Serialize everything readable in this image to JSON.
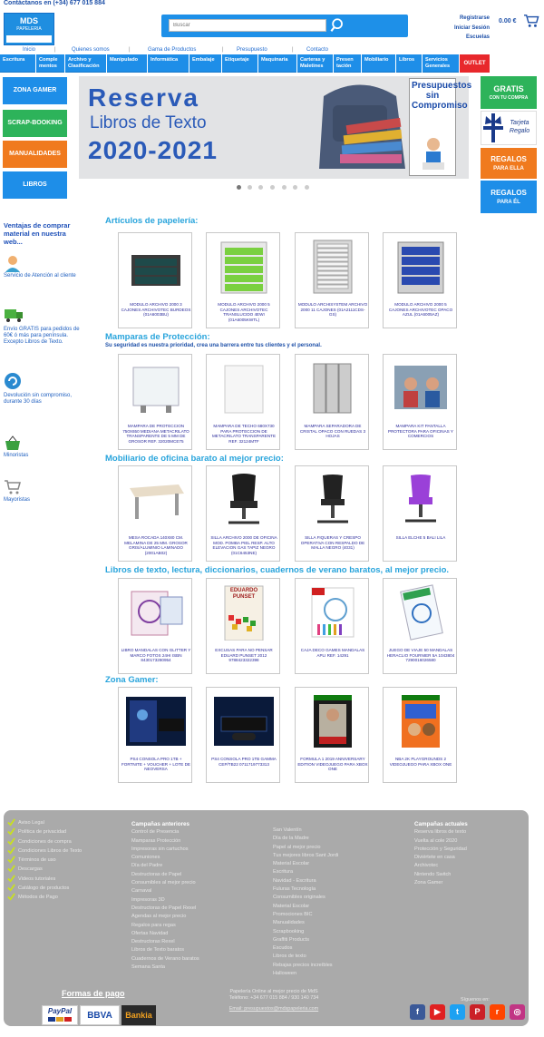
{
  "header": {
    "contact_line": "Contáctanos en (+34) 677 015 884",
    "logo_title": "MDS",
    "logo_sub": "PAPELERIA",
    "search_placeholder": "Buscar",
    "account_links": [
      "Registrarse",
      "Iniciar Sesión",
      "Escuelas"
    ],
    "cart_total": "0.00 €"
  },
  "top_links": [
    "Inicio",
    "Quienes somos",
    "Gama de Productos",
    "Presupuesto",
    "Contacto"
  ],
  "categories": [
    "Escritura",
    "Comple mentos",
    "Archivo y Clasificación",
    "Manipulado",
    "Informática",
    "Embalaje",
    "Etiquetaje",
    "Maquinaria",
    "Carteras y Maletines",
    "Presen tación",
    "Mobiliario",
    "Libros",
    "Servicios Generales"
  ],
  "outlet_label": "OUTLET",
  "left_buttons": [
    {
      "label": "ZONA GAMER",
      "color": "#1e8ee8"
    },
    {
      "label": "SCRAP-BOOKING",
      "color": "#2db35a"
    },
    {
      "label": "MANUALIDADES",
      "color": "#f07a1e"
    },
    {
      "label": "LIBROS",
      "color": "#1e8ee8"
    }
  ],
  "banner": {
    "line1": "Reserva",
    "line2": "Libros de Texto",
    "line3": "2020-2021",
    "side_text": "Presupuestos sin Compromiso"
  },
  "right_buttons": [
    {
      "label": "GRATIS",
      "sub": "CON TU COMPRA",
      "color": "#2db35a"
    },
    {
      "label": "Tarjeta Regalo",
      "sub": "",
      "color": "#ffffff"
    },
    {
      "label": "REGALOS",
      "sub": "PARA ELLA",
      "color": "#f07a1e"
    },
    {
      "label": "REGALOS",
      "sub": "PARA ÉL",
      "color": "#1e8ee8"
    }
  ],
  "advantages": {
    "title": "Ventajas de comprar material en nuestra web...",
    "items": [
      "Servicio de Atención al cliente",
      "Envío GRATIS para pedidos de 60€ ó más para península. Excepto Libros de Texto.",
      "Devolución sin compromiso, durante 30 días",
      "Minoristas",
      "Mayoristas"
    ]
  },
  "sections": [
    {
      "title": "Artículos de papelería:",
      "subtitle": "",
      "products": [
        "MODULO ARCHIVO 2000 3 CAJONES ARCHIVOTEC BURDEOS (01A6003BU)",
        "MODULO ARCHIVO 2000 5 CAJONES ARCHIVOTEC TRANSLUCIDO 4EWI (01A6005KWTL)",
        "MODULO ARCHISYSTEM ARCHIVO 2000 11 CAJONES (01A2111CDS-GS)",
        "MODULO ARCHIVO 2000 5 CAJONES ARCHIVOTEC OPACO AZUL (01A6005AZ)"
      ]
    },
    {
      "title": "Mamparas de Protección:",
      "subtitle": "Su seguridad es nuestra prioridad, crea una barrera entre tus clientes y el personal.",
      "products": [
        "MAMPARA DE PROTECCION 750x650 MEDIANA METACRILATO TRANSPARENTE DE 5 MM DE GROSOR REF. 32020MCE75",
        "MAMPARA DE TECHO 680x730 PARA PROTECCION DE METACRILATO TRANSPARENTE REF. 32124MTF",
        "MAMPARA SEPARADORA DE CRISTAL OPACO CON RUEDAS 3 HOJAS",
        "MAMPARA KIT PANTALLA PROTECTORA PARA OFICINAS Y COMERCIOS"
      ]
    },
    {
      "title": "Mobiliario de oficina barato al mejor precio:",
      "subtitle": "",
      "products": [
        "MESA ROCADA 140X80 CM. MELAMINA DE 25 MM. GROSOR GRIS/ALUMINIO LAMINADO (2001AB02)",
        "SILLA ARCHIVO 2000 DE OFICINA MOD. POMBA PIEL RESP. ALTO ELEVACION GAS TAPIZ NEGRO (01C6453NE)",
        "SILLA FIQUERAS Y CRESPO OPERATIVA CON RESPALDO DE MALLA NEGRO (4031)",
        "SILLA ELCHE 5 BALI LILA"
      ]
    },
    {
      "title": "Libros de texto, lectura, diccionarios, cuadernos de verano baratos, al mejor precio.",
      "subtitle": "",
      "products": [
        "LIBRO MANDALAS CON GLITTER Y MARCO FOTOS 24HI ISBN 8430173280954",
        "EXCUSAS PARA NO PENSAR EDUARD PUNSET 2012 9788423322398",
        "CAJA DECO GAMES MANDALAS APLI REF. 14291",
        "JUEGO DE VIAJE 50 MANDALAS HERACLIO FOURNIER 5A 1043804 7290016026580"
      ]
    },
    {
      "title": "Zona Gamer:",
      "subtitle": "",
      "products": [
        "PS4 CONSOLA PRO 1TB + FORTNITE + VOUCHER + LOTE DE NEOVERSA",
        "PS4 CONSOLA PRO 1TB GAMMA CEP/TB22 0711719773313",
        "FORMULA 1 2019 ANNIVERSARY EDITION VIDEOJUEGO PARA XBOX ONE",
        "NBA 2K PLAYGROUNDS 2 VIDEOJUEGO PARA XBOX ONE"
      ]
    }
  ],
  "book_cover_text": "EDUARDO PUNSET",
  "footer": {
    "col1": [
      "Aviso Legal",
      "Política de privacidad",
      "Condiciones de compra",
      "Condiciones Libros de Texto",
      "Términos de uso",
      "Descargas",
      "Videos tutoriales",
      "Catálogo de productos",
      "Métodos de Pago"
    ],
    "col2_title": "Campañas anteriores",
    "col2": [
      "Control de Presencia",
      "Mamparas Protección",
      "Impresoras sin cartuchos",
      "Comuniones",
      "Día del Padre",
      "Destructoras de Papel",
      "Consumibles al mejor precio",
      "Carnaval",
      "Impresoras 3D",
      "Destructoras de Papel Rexel",
      "Agendas al mejor precio",
      "Regalos para regas",
      "Ofertas Navidad",
      "Destructoras Rexel",
      "Libros de Texto baratos",
      "Cuadernos de Verano baratos",
      "Semana Santa"
    ],
    "col3": [
      "San Valentín",
      "Día de la Madre",
      "Papel al mejor precio",
      "Tus mejores libros Sant Jordi",
      "Material Escolar",
      "Escritura",
      "Navidad - Escritura",
      "Fuluras Tecnología",
      "Consumibles originales",
      "Material Escolar",
      "Promociones BIC",
      "Manualidades",
      "Scrapbooking",
      "Graffiti Products",
      "Escudos",
      "Libros de texto",
      "Rebajas precios increíbles",
      "Halloween"
    ],
    "col4_title": "Campañas actuales",
    "col4": [
      "Reserva libros de texto",
      "Vuelta al cole 2020",
      "Protección y Seguridad",
      "Diviértete en casa",
      "Archivotec",
      "Nintendo Switch",
      "Zona Gamer"
    ],
    "payment_title": "Formas de pago",
    "payment_logos": [
      "PayPal",
      "BBVA",
      "Bankia"
    ],
    "company": "Papelería Online al mejor precio de MdS",
    "phone": "Teléfono: +34 677 015 884 / 930 140 734",
    "email": "Email: presupuestos@mdspapeleria.com",
    "follow": "Síguenos en:",
    "social": [
      "f",
      "▶",
      "t",
      "P",
      "r",
      "◎"
    ]
  }
}
